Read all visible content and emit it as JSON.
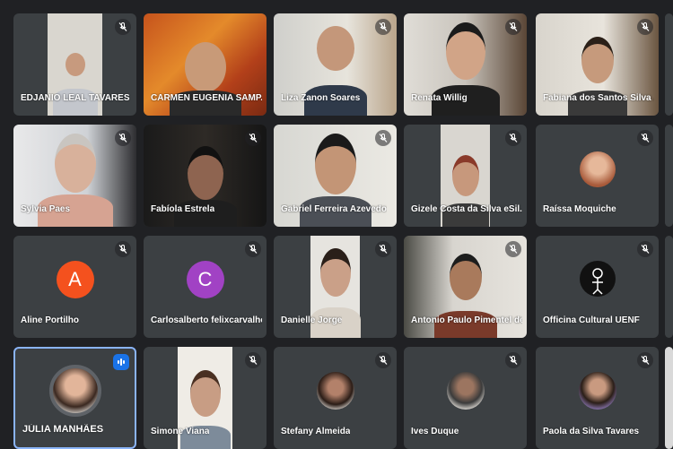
{
  "participants": [
    {
      "name": "EDJANIO LEAL TAVARES",
      "mic_icon": "mic-off-icon"
    },
    {
      "name": "CARMEN EUGENIA SAMP...",
      "mic_icon": "mic-off-icon"
    },
    {
      "name": "Liza Zanon Soares",
      "mic_icon": "mic-off-icon"
    },
    {
      "name": "Renata Willig",
      "mic_icon": "mic-off-icon"
    },
    {
      "name": "Fabiana dos Santos Silva ...",
      "mic_icon": "mic-off-icon"
    },
    {
      "name": "Sylvia Paes",
      "mic_icon": "mic-off-icon"
    },
    {
      "name": "Fabíola Estrela",
      "mic_icon": "mic-off-icon"
    },
    {
      "name": "Gabriel Ferreira Azevedo",
      "mic_icon": "mic-off-icon"
    },
    {
      "name": "Gizele Costa da Silva eSil...",
      "mic_icon": "mic-off-icon"
    },
    {
      "name": "Raíssa Moquiche",
      "mic_icon": "mic-off-icon"
    },
    {
      "name": "Aline Portilho",
      "mic_icon": "mic-off-icon",
      "avatar_letter": "A",
      "avatar_color": "#f4511e"
    },
    {
      "name": "Carlosalberto felixcarvalho",
      "mic_icon": "mic-off-icon",
      "avatar_letter": "C",
      "avatar_color": "#a142c4"
    },
    {
      "name": "Danielle Jorge",
      "mic_icon": "mic-off-icon"
    },
    {
      "name": "Antonio Paulo Pimentel de...",
      "mic_icon": "mic-off-icon"
    },
    {
      "name": "Officina Cultural UENF",
      "mic_icon": "mic-off-icon"
    },
    {
      "name": "JÚLIA MANHÃES",
      "mic_icon": "speaking-icon",
      "active_speaker": true
    },
    {
      "name": "Simone Viana",
      "mic_icon": "mic-off-icon"
    },
    {
      "name": "Stefany Almeida",
      "mic_icon": "mic-off-icon"
    },
    {
      "name": "Ives Duque",
      "mic_icon": "mic-off-icon"
    },
    {
      "name": "Paola da Silva Tavares",
      "mic_icon": "mic-off-icon"
    }
  ],
  "colors": {
    "background": "#202124",
    "tile": "#3c4043",
    "active_border": "#8ab4f8",
    "speaking": "#1a73e8"
  }
}
